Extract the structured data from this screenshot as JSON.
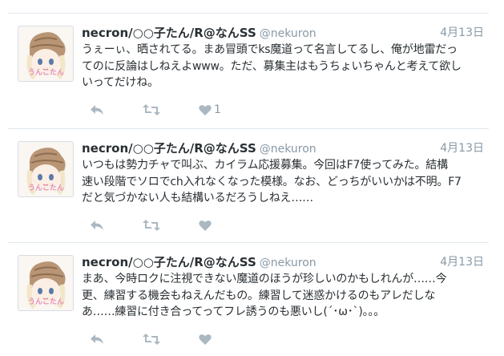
{
  "tweets": [
    {
      "name": "necron/○○子たん/R@なんSS",
      "handle": "@nekuron",
      "date": "4月13日",
      "lines": [
        "うぇーぃ、晒されてる。まあ冒頭でks魔道って名言してるし、俺が地雷だっ",
        "てのに反論はしねえよwww。ただ、募集主はもうちょいちゃんと考えて欲し",
        "いってだけね。"
      ],
      "likes": "1",
      "avatar_text": "うんこたん"
    },
    {
      "name": "necron/○○子たん/R@なんSS",
      "handle": "@nekuron",
      "date": "4月13日",
      "lines": [
        "いつもは勢力チャで叫ぶ、カイラム応援募集。今回はF7使ってみた。結構",
        "速い段階でソロでch入れなくなった模様。なお、どっちがいいかは不明。F7",
        "だと気づかない人も結構いるだろうしねえ……"
      ],
      "likes": "",
      "avatar_text": "うんこたん"
    },
    {
      "name": "necron/○○子たん/R@なんSS",
      "handle": "@nekuron",
      "date": "4月13日",
      "lines": [
        "まあ、今時ロクに注視できない魔道のほうが珍しいのかもしれんが……今",
        "更、練習する機会もねえんだもの。練習して迷惑かけるのもアレだしな",
        "あ……練習に付き合ってってフレ誘うのも悪いし(´･ω･`)。。。"
      ],
      "likes": "",
      "avatar_text": "うんこたん"
    }
  ],
  "icons": [
    "reply-icon",
    "retweet-icon",
    "like-icon"
  ],
  "colors": {
    "text": "#292f33",
    "muted": "#8899a6",
    "icon": "#aab8c2",
    "border": "#e1e8ed"
  }
}
